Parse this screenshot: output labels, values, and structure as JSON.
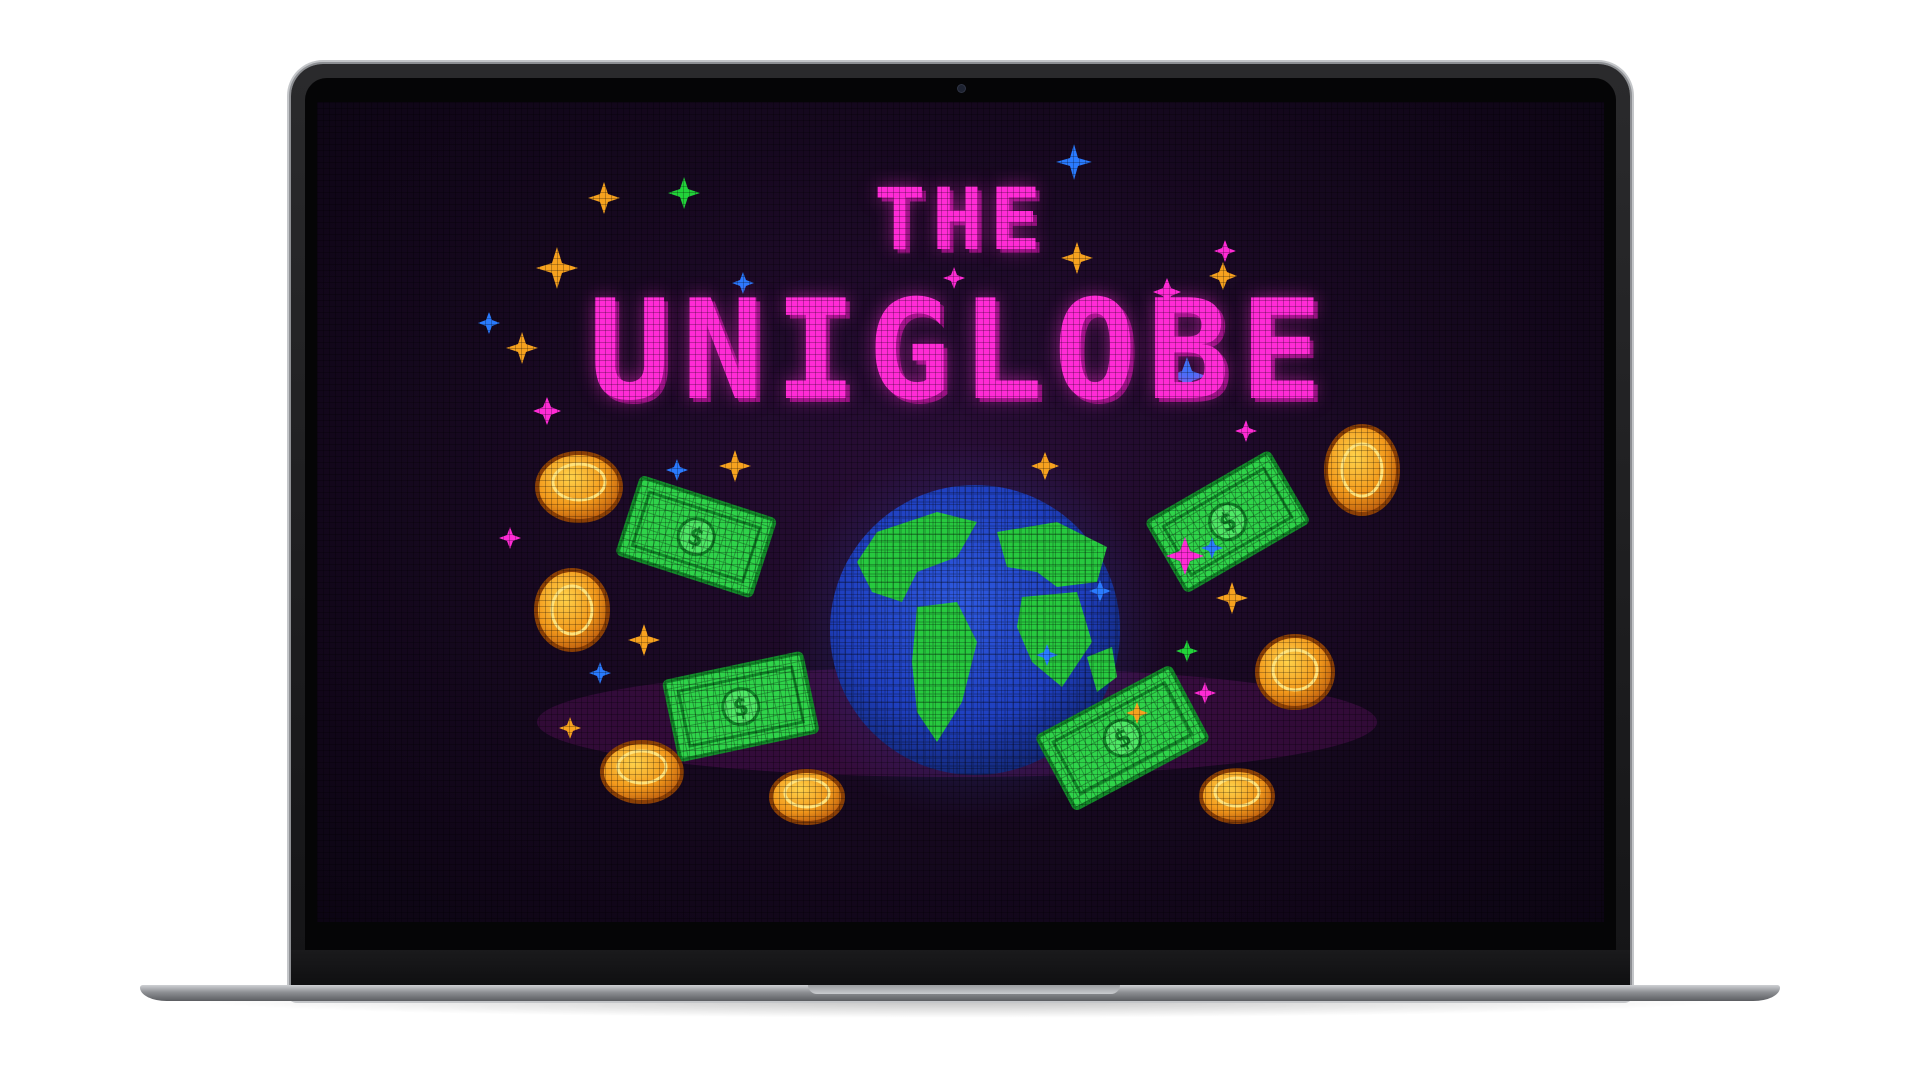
{
  "screen": {
    "title_line1": "THE",
    "title_line2": "UNIGLOBE"
  },
  "colors": {
    "title": "#ff2bd6",
    "globe_ocean": "#1f3fbf",
    "globe_land": "#27c93f",
    "coin": "#f39a1c",
    "bill": "#2fd34a",
    "background": "#16081f"
  },
  "icons": [
    "globe-icon",
    "coin-icon",
    "dollar-bill-icon",
    "sparkle-icon"
  ]
}
